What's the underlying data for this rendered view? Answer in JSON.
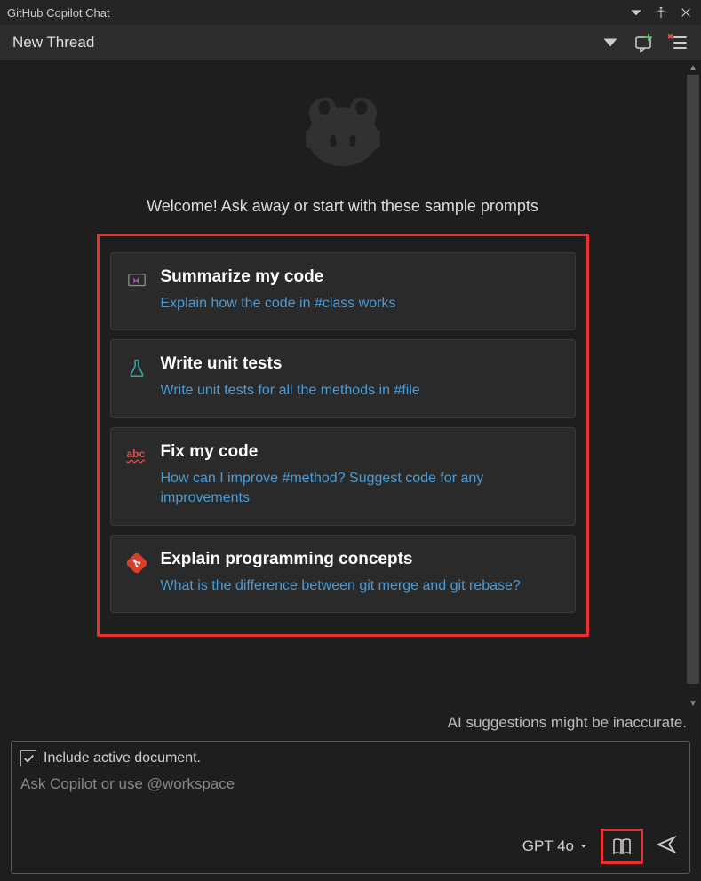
{
  "titlebar": {
    "title": "GitHub Copilot Chat"
  },
  "threadbar": {
    "title": "New Thread"
  },
  "welcome_text": "Welcome! Ask away or start with these sample prompts",
  "cards": [
    {
      "title": "Summarize my code",
      "subtitle": "Explain how the code in #class works"
    },
    {
      "title": "Write unit tests",
      "subtitle": "Write unit tests for all the methods in #file"
    },
    {
      "title": "Fix my code",
      "subtitle": "How can I improve #method? Suggest code for any improvements"
    },
    {
      "title": "Explain programming concepts",
      "subtitle": "What is the difference between git merge and git rebase?"
    }
  ],
  "disclaimer": "AI suggestions might be inaccurate.",
  "input": {
    "include_doc_label": "Include active document.",
    "include_doc_checked": true,
    "placeholder": "Ask Copilot or use @workspace",
    "model": "GPT 4o"
  }
}
